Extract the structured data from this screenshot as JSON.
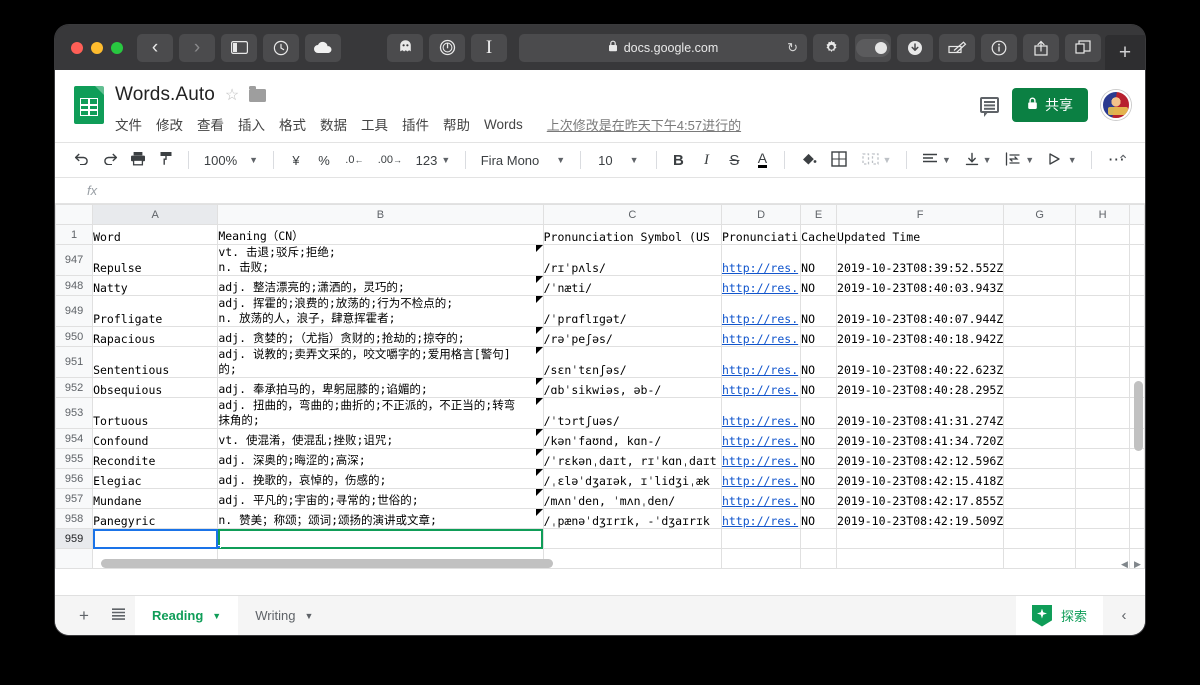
{
  "browser": {
    "url": "docs.google.com",
    "lock_icon": "lock-icon",
    "reload_icon": "↻",
    "back_icon": "‹",
    "forward_icon": "›",
    "sidebar_icon": "sidebar-icon",
    "history_icon": "clock-icon",
    "cloud_icon": "cloud-icon",
    "extension_icons": [
      "ghostery-icon",
      "one-password-icon",
      "instapaper-icon"
    ],
    "download_icon": "download-icon",
    "edit_icon": "annotate-icon",
    "info_icon": "info-icon",
    "share_icon": "share-icon",
    "tabs_icon": "tabs-icon",
    "newtab_label": "+",
    "settings_icon": "gear-icon",
    "reader_toggle": "toggle-switch"
  },
  "docs": {
    "title": "Words.Auto",
    "star": "☆",
    "folder_icon": "folder-icon",
    "menus": [
      "文件",
      "修改",
      "查看",
      "插入",
      "格式",
      "数据",
      "工具",
      "插件",
      "帮助",
      "Words"
    ],
    "last_edit": "上次修改是在昨天下午4:57进行的",
    "share_label": "共享",
    "comment_icon": "comment-icon",
    "avatar": "user-avatar"
  },
  "toolbar": {
    "undo": "↶",
    "redo": "↷",
    "print": "print-icon",
    "paint": "paint-format-icon",
    "zoom": "100%",
    "currency": "¥",
    "percent": "%",
    "decrease_decimal": ".0",
    "increase_decimal": ".00",
    "more_formats": "123",
    "font": "Fira Mono",
    "font_size": "10",
    "bold": "B",
    "italic": "I",
    "strikethrough": "S",
    "text_color": "A",
    "fill_color": "fill-color-icon",
    "borders": "borders-icon",
    "merge": "merge-cells-icon",
    "halign": "horizontal-align-icon",
    "valign": "vertical-align-icon",
    "wrap": "text-wrap-icon",
    "rotate": "text-rotation-icon",
    "more": "⋯",
    "collapse": "⌃"
  },
  "formula_bar": {
    "fx": "fx",
    "value": ""
  },
  "sheet": {
    "columns": [
      "A",
      "B",
      "C",
      "D",
      "E",
      "F",
      "G",
      "H"
    ],
    "selected_column": "A",
    "header_row_number": "1",
    "headers": {
      "a": "Word",
      "b": "Meaning（CN）",
      "c": "Pronunciation Symbol (US",
      "d": "Pronunciati",
      "e": "Cache",
      "f": "Updated Time",
      "g": "",
      "h": ""
    },
    "link_text": "http://res.",
    "cache_value": "NO",
    "rows": [
      {
        "n": "947",
        "word": "Repulse",
        "meaning1": "vt. 击退;驳斥;拒绝;",
        "meaning2": "n. 击败;",
        "ipa": "/rɪˈpʌls/",
        "link": "http://res.",
        "cache": "NO",
        "updated": "2019-10-23T08:39:52.552Z"
      },
      {
        "n": "948",
        "word": "Natty",
        "meaning1": "adj. 整洁漂亮的;潇洒的，灵巧的;",
        "meaning2": "",
        "ipa": "/ˈnæti/",
        "link": "http://res.",
        "cache": "NO",
        "updated": "2019-10-23T08:40:03.943Z"
      },
      {
        "n": "949",
        "word": "Profligate",
        "meaning1": "adj. 挥霍的;浪费的;放荡的;行为不检点的;",
        "meaning2": "n. 放荡的人，浪子，肆意挥霍者;",
        "ipa": "/ˈprɑflɪgət/",
        "link": "http://res.",
        "cache": "NO",
        "updated": "2019-10-23T08:40:07.944Z"
      },
      {
        "n": "950",
        "word": "Rapacious",
        "meaning1": "adj. 贪婪的;（尤指）贪财的;抢劫的;掠夺的;",
        "meaning2": "",
        "ipa": "/rəˈpeʃəs/",
        "link": "http://res.",
        "cache": "NO",
        "updated": "2019-10-23T08:40:18.942Z"
      },
      {
        "n": "951",
        "word": "Sententious",
        "meaning1": "adj. 说教的;卖弄文采的，咬文嚼字的;爱用格言[警句]",
        "meaning2": "的;",
        "ipa": "/sɛnˈtɛnʃəs/",
        "link": "http://res.",
        "cache": "NO",
        "updated": "2019-10-23T08:40:22.623Z"
      },
      {
        "n": "952",
        "word": "Obsequious",
        "meaning1": "adj. 奉承拍马的，卑躬屈膝的;谄媚的;",
        "meaning2": "",
        "ipa": "/ɑbˈsikwiəs, əb-/",
        "link": "http://res.",
        "cache": "NO",
        "updated": "2019-10-23T08:40:28.295Z"
      },
      {
        "n": "953",
        "word": "Tortuous",
        "meaning1": "adj. 扭曲的，弯曲的;曲折的;不正派的，不正当的;转弯",
        "meaning2": "抹角的;",
        "ipa": "/ˈtɔrtʃuəs/",
        "link": "http://res.",
        "cache": "NO",
        "updated": "2019-10-23T08:41:31.274Z"
      },
      {
        "n": "954",
        "word": "Confound",
        "meaning1": "vt. 使混淆，使混乱;挫败;诅咒;",
        "meaning2": "",
        "ipa": "/kənˈfaʊnd, kɑn-/",
        "link": "http://res.",
        "cache": "NO",
        "updated": "2019-10-23T08:41:34.720Z"
      },
      {
        "n": "955",
        "word": "Recondite",
        "meaning1": "adj. 深奥的;晦涩的;高深;",
        "meaning2": "",
        "ipa": "/ˈrɛkənˌdaɪt, rɪˈkɑnˌdaɪt",
        "link": "http://res.",
        "cache": "NO",
        "updated": "2019-10-23T08:42:12.596Z"
      },
      {
        "n": "956",
        "word": "Elegiac",
        "meaning1": "adj. 挽歌的，哀悼的，伤感的;",
        "meaning2": "",
        "ipa": "/ˌɛləˈdʒaɪək, ɪˈlidʒiˌæk",
        "link": "http://res.",
        "cache": "NO",
        "updated": "2019-10-23T08:42:15.418Z"
      },
      {
        "n": "957",
        "word": "Mundane",
        "meaning1": "adj. 平凡的;宇宙的;寻常的;世俗的;",
        "meaning2": "",
        "ipa": "/mʌnˈden, ˈmʌnˌden/",
        "link": "http://res.",
        "cache": "NO",
        "updated": "2019-10-23T08:42:17.855Z"
      },
      {
        "n": "958",
        "word": "Panegyric",
        "meaning1": "n. 赞美；称颂；颂词;颂扬的演讲或文章;",
        "meaning2": "",
        "ipa": "/ˌpænəˈdʒɪrɪk, -ˈdʒaɪrɪk",
        "link": "http://res.",
        "cache": "NO",
        "updated": "2019-10-23T08:42:19.509Z"
      },
      {
        "n": "959",
        "word": "",
        "meaning1": "",
        "meaning2": "",
        "ipa": "",
        "link": "",
        "cache": "",
        "updated": ""
      }
    ]
  },
  "bottom": {
    "add_sheet": "+",
    "all_sheets": "all-sheets-icon",
    "tabs": [
      {
        "label": "Reading",
        "active": true
      },
      {
        "label": "Writing",
        "active": false
      }
    ],
    "explore_label": "探索",
    "collapse": "‹"
  },
  "colors": {
    "sheets_green": "#0f9d58",
    "share_green": "#0b8043",
    "link_blue": "#1155cc",
    "selection_blue": "#1a73e8",
    "selection_green": "#0f9d58"
  }
}
